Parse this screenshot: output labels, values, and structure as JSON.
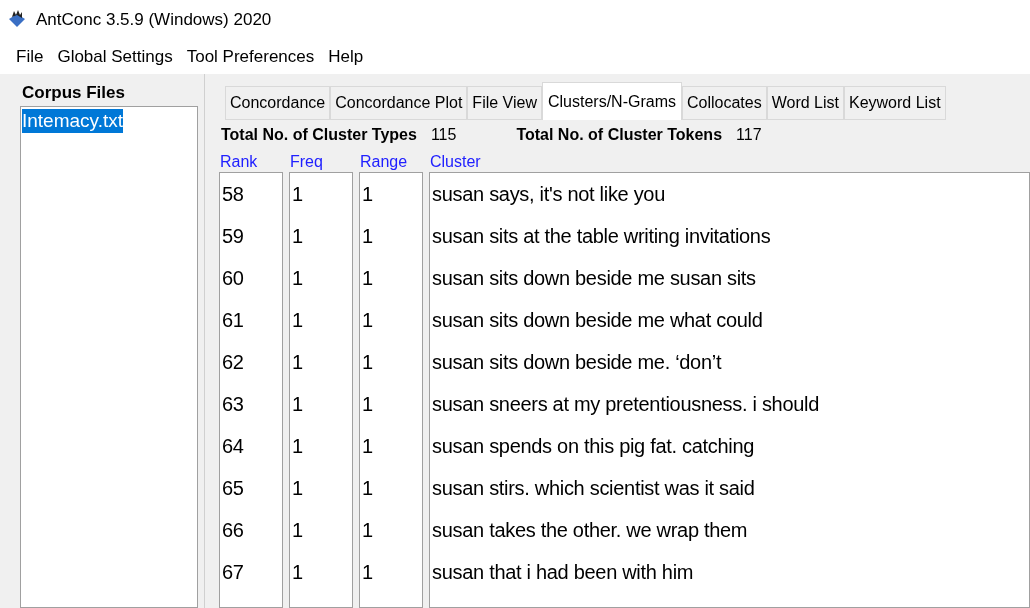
{
  "window": {
    "title": "AntConc 3.5.9 (Windows) 2020"
  },
  "menu": [
    "File",
    "Global Settings",
    "Tool Preferences",
    "Help"
  ],
  "corpus_files": {
    "heading": "Corpus Files",
    "items": [
      {
        "label": "Intemacy.txt",
        "selected": true
      }
    ]
  },
  "tabs": [
    {
      "label": "Concordance",
      "selected": false
    },
    {
      "label": "Concordance Plot",
      "selected": false
    },
    {
      "label": "File View",
      "selected": false
    },
    {
      "label": "Clusters/N-Grams",
      "selected": true
    },
    {
      "label": "Collocates",
      "selected": false
    },
    {
      "label": "Word List",
      "selected": false
    },
    {
      "label": "Keyword List",
      "selected": false
    }
  ],
  "totals": [
    {
      "label": "Total No. of Cluster Types",
      "value": "115"
    },
    {
      "label": "Total No. of Cluster Tokens",
      "value": "117"
    }
  ],
  "table": {
    "columns": [
      "Rank",
      "Freq",
      "Range",
      "Cluster"
    ],
    "rows": [
      [
        "58",
        "1",
        "1",
        "susan says,  it's not like you"
      ],
      [
        "59",
        "1",
        "1",
        "susan sits at the table writing invitations"
      ],
      [
        "60",
        "1",
        "1",
        "susan sits down beside me  susan sits"
      ],
      [
        "61",
        "1",
        "1",
        "susan sits down beside me  what could"
      ],
      [
        "62",
        "1",
        "1",
        "susan sits down beside me.  ‘don’t"
      ],
      [
        "63",
        "1",
        "1",
        "susan sneers at my pretentiousness.  i should"
      ],
      [
        "64",
        "1",
        "1",
        "susan spends on this pig fat. catching"
      ],
      [
        "65",
        "1",
        "1",
        "susan stirs.  which scientist was it said"
      ],
      [
        "66",
        "1",
        "1",
        "susan takes the other.  we wrap them"
      ],
      [
        "67",
        "1",
        "1",
        "susan that i had been with him"
      ]
    ]
  }
}
